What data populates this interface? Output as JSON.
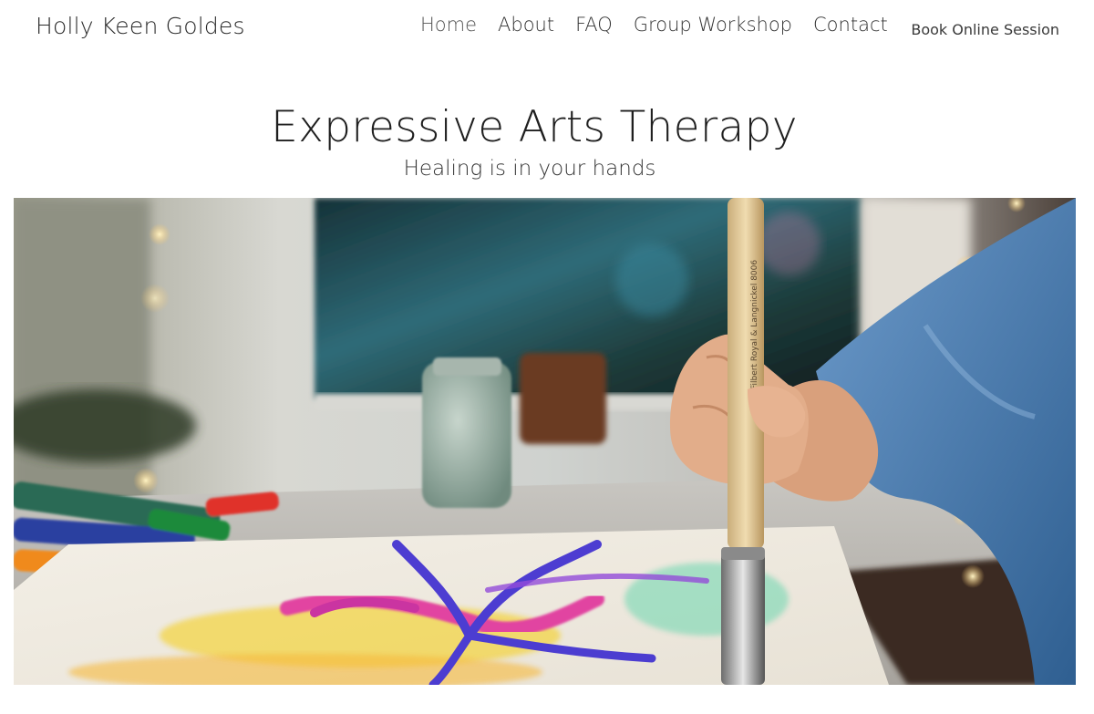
{
  "header": {
    "site_title": "Holly Keen Goldes",
    "nav": [
      {
        "label": "Home",
        "active": true
      },
      {
        "label": "About",
        "active": false
      },
      {
        "label": "FAQ",
        "active": false
      },
      {
        "label": "Group Workshop",
        "active": false
      },
      {
        "label": "Contact",
        "active": false
      }
    ],
    "book_link": "Book Online Session"
  },
  "hero": {
    "heading": "Expressive Arts Therapy",
    "subtitle": "Healing is in your hands",
    "image": {
      "icon": "painting-photo",
      "description_colors": {
        "paint_pink": "#e0309a",
        "paint_blue": "#3a2ad0",
        "paint_yellow": "#f4d02a",
        "sleeve_blue": "#4b7fb8"
      }
    }
  },
  "theme": {
    "background": "#ffffff",
    "text": "#2b2b2b"
  }
}
